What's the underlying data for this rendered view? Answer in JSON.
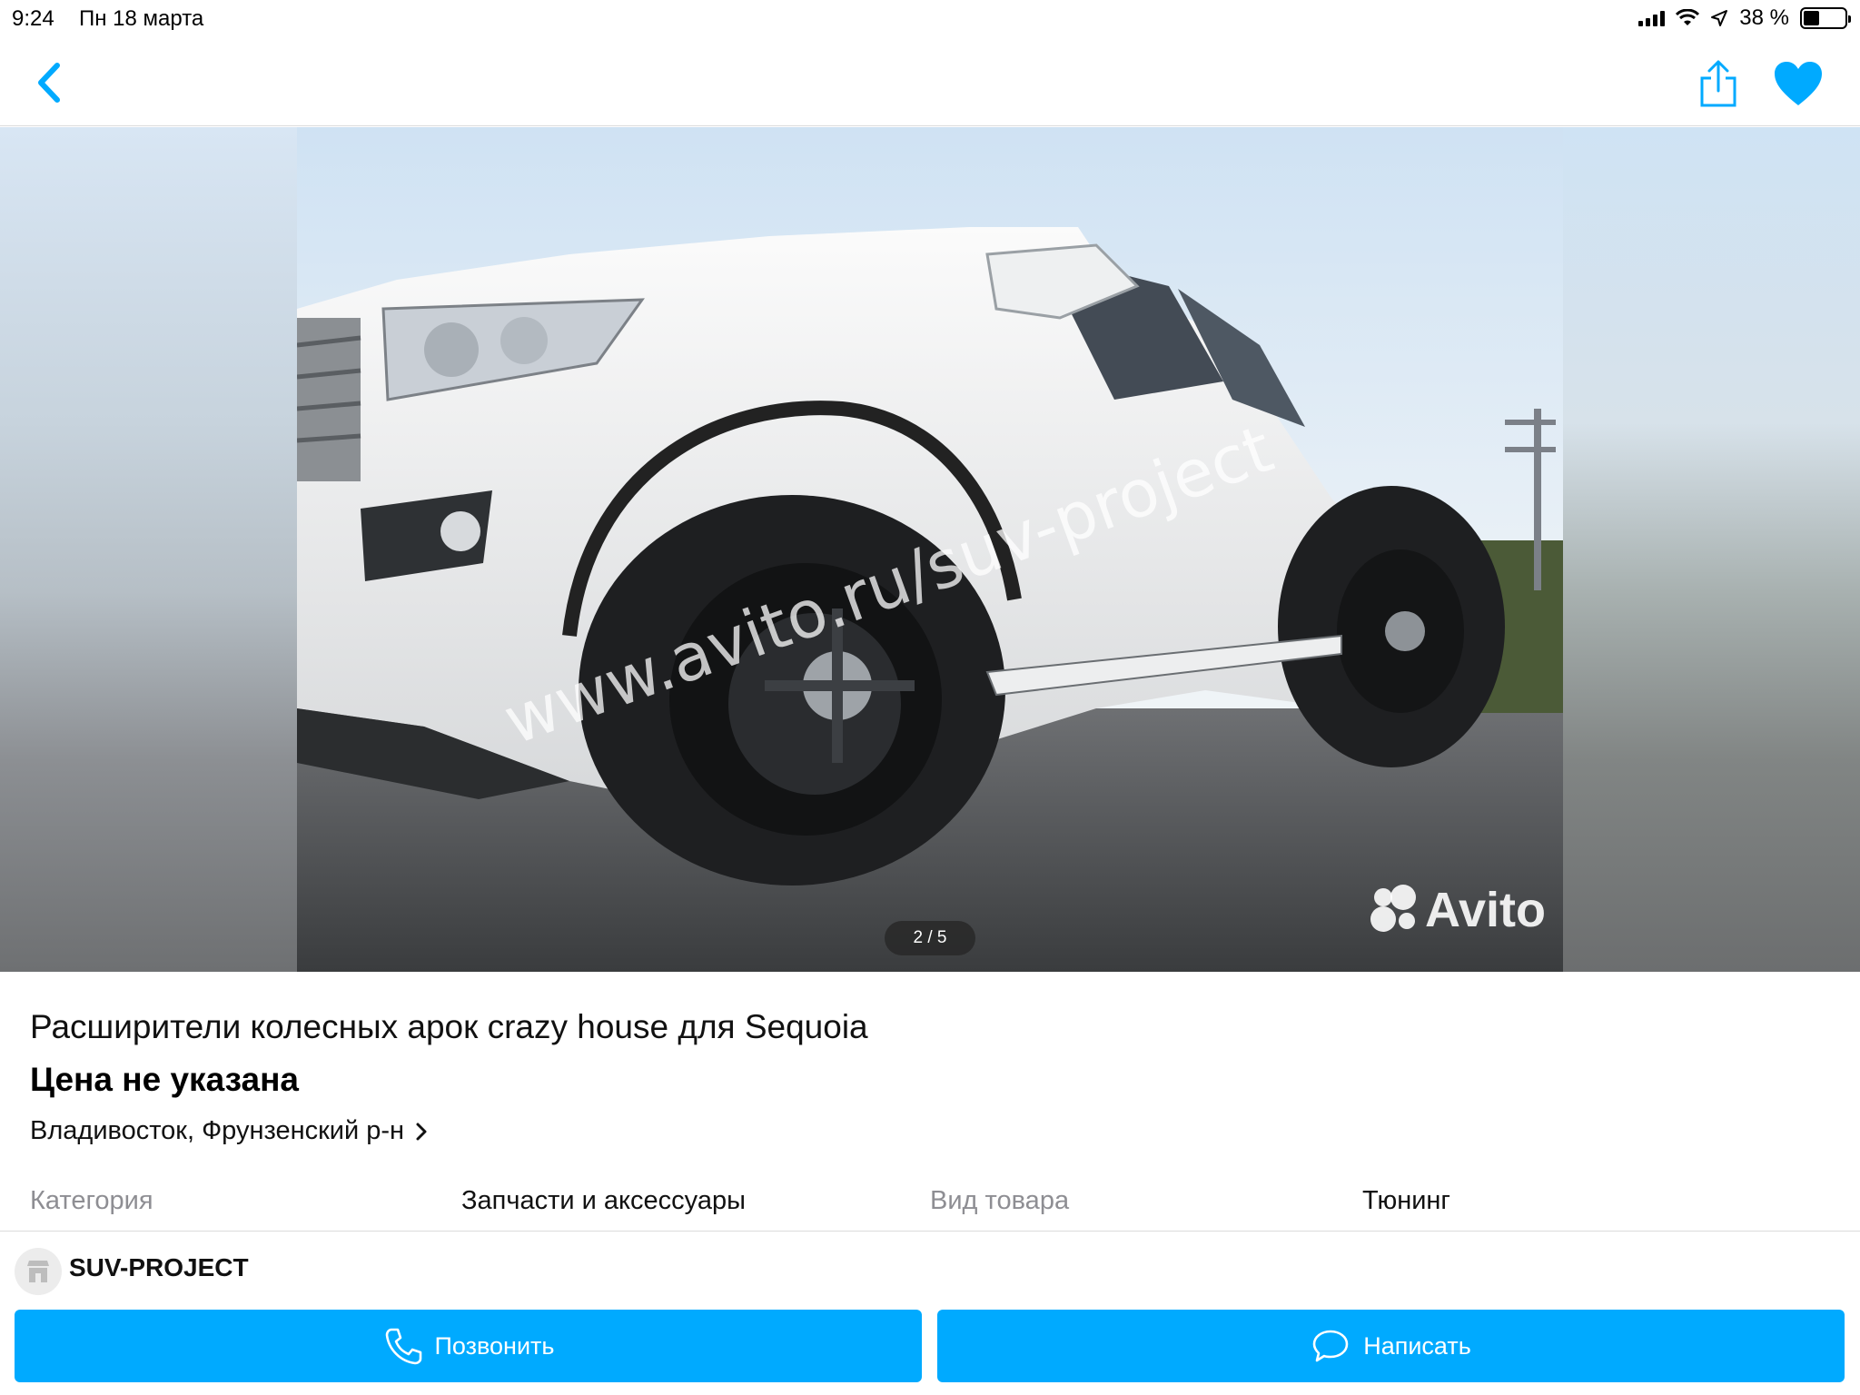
{
  "status_bar": {
    "time": "9:24",
    "date": "Пн 18 марта",
    "battery_text": "38 %",
    "battery_level": 0.38,
    "icons": [
      "signal-icon",
      "wifi-icon",
      "location-arrow-icon",
      "battery-icon"
    ]
  },
  "navbar": {
    "back_icon": "chevron-left-icon",
    "share_icon": "share-icon",
    "favorite_icon": "heart-icon",
    "accent_color": "#00aaff"
  },
  "gallery": {
    "counter": "2 / 5",
    "watermark_text": "www.avito.ru/suv-project",
    "logo_text": "Avito"
  },
  "listing": {
    "title": "Расширители колесных арок crazy house для Sequoia",
    "price": "Цена не указана",
    "location": "Владивосток, Фрунзенский р-н"
  },
  "params": [
    {
      "key": "Категория",
      "value": "Запчасти и аксессуары"
    },
    {
      "key": "Вид товара",
      "value": "Тюнинг"
    }
  ],
  "seller": {
    "name": "SUV-PROJECT"
  },
  "actions": {
    "call_label": "Позвонить",
    "write_label": "Написать",
    "button_color": "#00aaff"
  }
}
